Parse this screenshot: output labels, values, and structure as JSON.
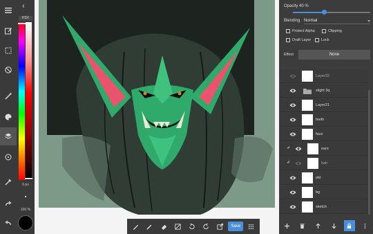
{
  "color_panel": {
    "mode_label": "HSV",
    "brush_size": "6 px",
    "opacity": "100 %",
    "current_color": "#000000"
  },
  "toolbar": {
    "icons": [
      "menu-icon",
      "edit-icon",
      "select-icon",
      "no-entry-icon",
      "brush-icon",
      "palette-icon",
      "layers-icon",
      "circle-icon",
      "eyedropper-icon",
      "redo-icon",
      "undo-icon"
    ]
  },
  "bottom_tools": {
    "save_label": "Save"
  },
  "layer_panel": {
    "opacity_label": "Opacity 40 %",
    "opacity_value": 0.4,
    "blending_label": "Blending",
    "blending_value": "Normal",
    "protect_alpha": "Protect Alpha",
    "clipping": "Clipping",
    "draft_layer": "Draft Layer",
    "lock": "Lock",
    "effect_label": "Effect",
    "effect_value": "None",
    "layers": [
      {
        "name": "Layer32",
        "visible": false,
        "clipped": false,
        "folder": false
      },
      {
        "name": "slight 3q",
        "visible": true,
        "clipped": false,
        "folder": true
      },
      {
        "name": "Layer21",
        "visible": true,
        "clipped": false,
        "folder": false
      },
      {
        "name": "teeth",
        "visible": true,
        "clipped": false,
        "folder": false
      },
      {
        "name": "face",
        "visible": true,
        "clipped": false,
        "folder": false
      },
      {
        "name": "ears",
        "visible": true,
        "clipped": true,
        "folder": false
      },
      {
        "name": "hair",
        "visible": false,
        "clipped": true,
        "folder": false
      },
      {
        "name": "old",
        "visible": true,
        "clipped": false,
        "folder": false
      },
      {
        "name": "bg",
        "visible": true,
        "clipped": false,
        "folder": false
      },
      {
        "name": "sketch",
        "visible": true,
        "clipped": false,
        "folder": false
      }
    ]
  },
  "colors": {
    "accent": "#4a8fd9",
    "canvas_bg": "#7d9a88",
    "dark_bg": "#1d2420",
    "skin": "#2faa6a",
    "ear_inner": "#e8546e"
  }
}
